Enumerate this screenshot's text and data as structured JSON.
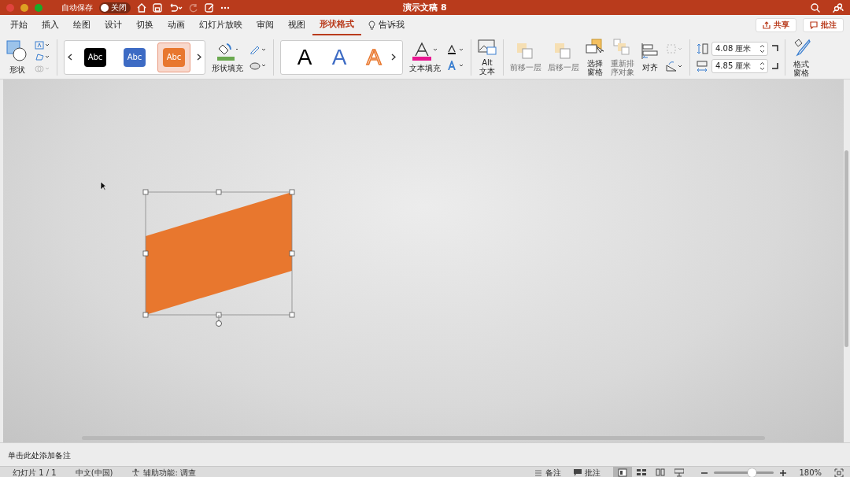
{
  "title_bar": {
    "autosave_label": "自动保存",
    "autosave_toggle": {
      "label": "关闭",
      "on": false
    },
    "title": "演示文稿 8"
  },
  "tabs": [
    {
      "label": "开始",
      "selected": false
    },
    {
      "label": "插入",
      "selected": false
    },
    {
      "label": "绘图",
      "selected": false
    },
    {
      "label": "设计",
      "selected": false
    },
    {
      "label": "切换",
      "selected": false
    },
    {
      "label": "动画",
      "selected": false
    },
    {
      "label": "幻灯片放映",
      "selected": false
    },
    {
      "label": "审阅",
      "selected": false
    },
    {
      "label": "视图",
      "selected": false
    },
    {
      "label": "形状格式",
      "selected": true
    }
  ],
  "tell_me": "告诉我",
  "share_button": "共享",
  "comments_button": "批注",
  "ribbon": {
    "shape_label": "形状",
    "shape_styles": [
      {
        "label": "Abc",
        "color": "#000000",
        "selected": false
      },
      {
        "label": "Abc",
        "color": "#3d6bc4",
        "selected": false
      },
      {
        "label": "Abc",
        "color": "#e8772e",
        "selected": true
      }
    ],
    "shape_fill": "形状填充",
    "wordart_styles": [
      {
        "label": "A",
        "kind": "solid"
      },
      {
        "label": "A",
        "kind": "blue"
      },
      {
        "label": "A",
        "kind": "outline"
      }
    ],
    "text_fill": "文本填充",
    "alt_text": [
      "Alt",
      "文本"
    ],
    "arrange": [
      {
        "lines": [
          "前移一层"
        ],
        "disabled": true
      },
      {
        "lines": [
          "后移一层"
        ],
        "disabled": true
      },
      {
        "lines": [
          "选择",
          "窗格"
        ],
        "disabled": false
      },
      {
        "lines": [
          "重新排",
          "序对象"
        ],
        "disabled": true
      },
      {
        "lines": [
          "对齐"
        ],
        "disabled": false
      }
    ],
    "height": "4.08 厘米",
    "width": "4.85 厘米",
    "format_pane": [
      "格式",
      "窗格"
    ]
  },
  "notes_placeholder": "单击此处添加备注",
  "status_bar": {
    "slide": "幻灯片 1 / 1",
    "language": "中文(中国)",
    "accessibility": "辅助功能: 调查",
    "notes": "备注",
    "comments": "批注",
    "views": [
      {
        "kind": "normal",
        "selected": true
      },
      {
        "kind": "sorter",
        "selected": false
      },
      {
        "kind": "reading",
        "selected": false
      },
      {
        "kind": "show",
        "selected": false
      }
    ],
    "zoom": {
      "level": 0.62,
      "reading": "180%"
    }
  }
}
